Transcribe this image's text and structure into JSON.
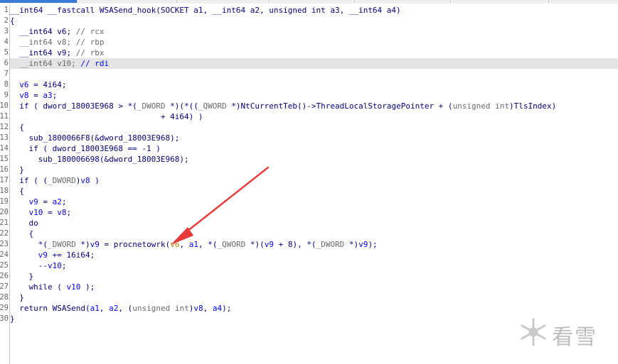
{
  "colors": {
    "keyword": "#000080",
    "variable": "#0000ff",
    "comment": "#6a6a6a",
    "highlight_line": "#e4e4e4",
    "arrow": "#e8393a",
    "watermark": "#bdbdbd"
  },
  "gutter": {
    "line_numbers": [
      "1",
      "2",
      "3",
      "4",
      "5",
      "6",
      "7",
      "8",
      "9",
      "10",
      "11",
      "12",
      "13",
      "14",
      "15",
      "16",
      "17",
      "18",
      "19",
      "20",
      "21",
      "22",
      "23",
      "24",
      "25",
      "26",
      "27",
      "28",
      "29",
      "30"
    ]
  },
  "code": {
    "lines": [
      {
        "segments": [
          {
            "text": "__int64 __fastcall WSASend_hook(SOCKET a1, __int64 a2, unsigned int a3, __int64 a4)",
            "style": "k"
          }
        ]
      },
      {
        "segments": [
          {
            "text": "{",
            "style": "k"
          }
        ]
      },
      {
        "segments": [
          {
            "text": "  __int64 v6; ",
            "style": "k"
          },
          {
            "text": "// rcx",
            "style": "cm"
          }
        ]
      },
      {
        "segments": [
          {
            "text": "  ",
            "style": "k"
          },
          {
            "text": "__int64 v8; ",
            "style": "cm"
          },
          {
            "text": "// rbp",
            "style": "cm"
          }
        ]
      },
      {
        "segments": [
          {
            "text": "  __int64 v9; ",
            "style": "k"
          },
          {
            "text": "// rbx",
            "style": "cm"
          }
        ]
      },
      {
        "highlight": true,
        "segments": [
          {
            "text": "  ",
            "style": "k"
          },
          {
            "text": "__int64 v10; ",
            "style": "cm"
          },
          {
            "text": "// rdi",
            "style": "v"
          }
        ]
      },
      {
        "segments": [
          {
            "text": "",
            "style": "k"
          }
        ]
      },
      {
        "segments": [
          {
            "text": "  ",
            "style": "k"
          },
          {
            "text": "v6",
            "style": "v"
          },
          {
            "text": " = 4i64;",
            "style": "k"
          }
        ]
      },
      {
        "segments": [
          {
            "text": "  ",
            "style": "k"
          },
          {
            "text": "v8",
            "style": "v"
          },
          {
            "text": " = ",
            "style": "k"
          },
          {
            "text": "a3",
            "style": "v"
          },
          {
            "text": ";",
            "style": "k"
          }
        ]
      },
      {
        "segments": [
          {
            "text": "  if ( dword_18003E968 > *(",
            "style": "k"
          },
          {
            "text": "_DWORD",
            "style": "cm"
          },
          {
            "text": " *)(*((",
            "style": "k"
          },
          {
            "text": "_QWORD",
            "style": "cm"
          },
          {
            "text": " *)NtCurrentTeb()->ThreadLocalStoragePointer + (",
            "style": "k"
          },
          {
            "text": "unsigned int",
            "style": "cm"
          },
          {
            "text": ")TlsIndex)",
            "style": "k"
          }
        ]
      },
      {
        "segments": [
          {
            "text": "                                + 4i64) )",
            "style": "k"
          }
        ]
      },
      {
        "segments": [
          {
            "text": "  {",
            "style": "k"
          }
        ]
      },
      {
        "segments": [
          {
            "text": "    sub_1800066F8(&dword_18003E968);",
            "style": "k"
          }
        ]
      },
      {
        "segments": [
          {
            "text": "    if ( dword_18003E968 == -1 )",
            "style": "k"
          }
        ]
      },
      {
        "segments": [
          {
            "text": "      sub_180006698(&dword_18003E968);",
            "style": "k"
          }
        ]
      },
      {
        "segments": [
          {
            "text": "  }",
            "style": "k"
          }
        ]
      },
      {
        "segments": [
          {
            "text": "  if ( (",
            "style": "k"
          },
          {
            "text": "_DWORD",
            "style": "cm"
          },
          {
            "text": ")",
            "style": "k"
          },
          {
            "text": "v8",
            "style": "v"
          },
          {
            "text": " )",
            "style": "k"
          }
        ]
      },
      {
        "segments": [
          {
            "text": "  {",
            "style": "k"
          }
        ]
      },
      {
        "segments": [
          {
            "text": "    ",
            "style": "k"
          },
          {
            "text": "v9",
            "style": "v"
          },
          {
            "text": " = ",
            "style": "k"
          },
          {
            "text": "a2",
            "style": "v"
          },
          {
            "text": ";",
            "style": "k"
          }
        ]
      },
      {
        "segments": [
          {
            "text": "    ",
            "style": "k"
          },
          {
            "text": "v10",
            "style": "v"
          },
          {
            "text": " = ",
            "style": "k"
          },
          {
            "text": "v8",
            "style": "v"
          },
          {
            "text": ";",
            "style": "k"
          }
        ]
      },
      {
        "segments": [
          {
            "text": "    do",
            "style": "k"
          }
        ]
      },
      {
        "segments": [
          {
            "text": "    {",
            "style": "k"
          }
        ]
      },
      {
        "segments": [
          {
            "text": "      *(",
            "style": "k"
          },
          {
            "text": "_DWORD",
            "style": "cm"
          },
          {
            "text": " *)",
            "style": "k"
          },
          {
            "text": "v9",
            "style": "v"
          },
          {
            "text": " = procnetowrk(",
            "style": "k"
          },
          {
            "text": "v6",
            "style": "y"
          },
          {
            "text": ", ",
            "style": "k"
          },
          {
            "text": "a1",
            "style": "v"
          },
          {
            "text": ", *(",
            "style": "k"
          },
          {
            "text": "_QWORD",
            "style": "cm"
          },
          {
            "text": " *)(",
            "style": "k"
          },
          {
            "text": "v9",
            "style": "v"
          },
          {
            "text": " + 8), *(",
            "style": "k"
          },
          {
            "text": "_DWORD",
            "style": "cm"
          },
          {
            "text": " *)",
            "style": "k"
          },
          {
            "text": "v9",
            "style": "v"
          },
          {
            "text": ");",
            "style": "k"
          }
        ]
      },
      {
        "segments": [
          {
            "text": "      ",
            "style": "k"
          },
          {
            "text": "v9",
            "style": "v"
          },
          {
            "text": " += 16i64;",
            "style": "k"
          }
        ]
      },
      {
        "segments": [
          {
            "text": "      --",
            "style": "k"
          },
          {
            "text": "v10",
            "style": "v"
          },
          {
            "text": ";",
            "style": "k"
          }
        ]
      },
      {
        "segments": [
          {
            "text": "    }",
            "style": "k"
          }
        ]
      },
      {
        "segments": [
          {
            "text": "    while ( ",
            "style": "k"
          },
          {
            "text": "v10",
            "style": "v"
          },
          {
            "text": " );",
            "style": "k"
          }
        ]
      },
      {
        "segments": [
          {
            "text": "  }",
            "style": "k"
          }
        ]
      },
      {
        "segments": [
          {
            "text": "  return WSASend(",
            "style": "k"
          },
          {
            "text": "a1",
            "style": "v"
          },
          {
            "text": ", ",
            "style": "k"
          },
          {
            "text": "a2",
            "style": "v"
          },
          {
            "text": ", (",
            "style": "k"
          },
          {
            "text": "unsigned int",
            "style": "cm"
          },
          {
            "text": ")",
            "style": "k"
          },
          {
            "text": "v8",
            "style": "v"
          },
          {
            "text": ", ",
            "style": "k"
          },
          {
            "text": "a4",
            "style": "v"
          },
          {
            "text": ");",
            "style": "k"
          }
        ]
      },
      {
        "segments": [
          {
            "text": "}",
            "style": "k"
          }
        ]
      }
    ]
  },
  "annotation": {
    "type": "red-arrow",
    "target": "procnetowrk-call"
  },
  "watermark": {
    "icon": "snowflake-logo-icon",
    "text": "看雪"
  }
}
